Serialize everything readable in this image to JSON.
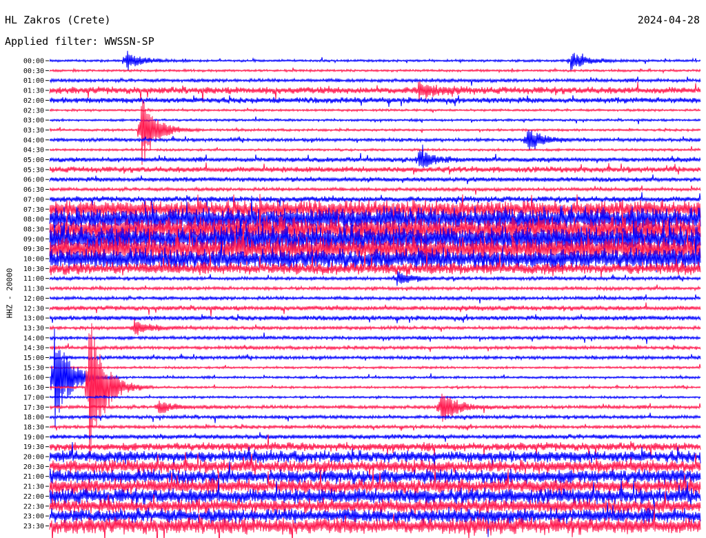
{
  "header": {
    "station": "HL Zakros (Crete)",
    "date": "2024-04-28",
    "filter": "Applied filter: WWSSN-SP"
  },
  "chart_data": {
    "type": "line",
    "ylabel": "HHZ - 20000",
    "yticks": [
      "00:00",
      "00:30",
      "01:00",
      "01:30",
      "02:00",
      "02:30",
      "03:00",
      "03:30",
      "04:00",
      "04:30",
      "05:00",
      "05:30",
      "06:00",
      "06:30",
      "07:00",
      "07:30",
      "08:00",
      "08:30",
      "09:00",
      "09:30",
      "10:00",
      "10:30",
      "11:00",
      "11:30",
      "12:00",
      "12:30",
      "13:00",
      "13:30",
      "14:00",
      "14:30",
      "15:00",
      "15:30",
      "16:00",
      "16:30",
      "17:00",
      "17:30",
      "18:00",
      "18:30",
      "19:00",
      "19:30",
      "20:00",
      "20:30",
      "21:00",
      "21:30",
      "22:00",
      "22:30",
      "23:00",
      "23:30"
    ],
    "colors": [
      "#0000ff",
      "#ff1a4f"
    ],
    "noise_level": [
      2,
      2,
      3,
      6,
      5,
      2,
      2,
      2,
      3,
      2,
      4,
      5,
      4,
      3,
      5,
      15,
      20,
      20,
      22,
      20,
      18,
      10,
      3,
      3,
      3,
      4,
      4,
      3,
      3,
      3,
      3,
      2,
      2,
      2,
      2,
      3,
      3,
      3,
      4,
      7,
      10,
      11,
      12,
      12,
      13,
      12,
      12,
      14
    ],
    "events": [
      {
        "time": "00:00",
        "minute": 3.5,
        "amp": 16
      },
      {
        "time": "00:00",
        "minute": 24,
        "amp": 14
      },
      {
        "time": "01:30",
        "minute": 17,
        "amp": 14
      },
      {
        "time": "03:30",
        "minute": 4.2,
        "amp": 60
      },
      {
        "time": "04:00",
        "minute": 22,
        "amp": 20
      },
      {
        "time": "05:00",
        "minute": 17,
        "amp": 14
      },
      {
        "time": "11:00",
        "minute": 16,
        "amp": 10
      },
      {
        "time": "13:30",
        "minute": 3.9,
        "amp": 12
      },
      {
        "time": "16:00",
        "minute": 0.2,
        "amp": 80
      },
      {
        "time": "16:30",
        "minute": 1.8,
        "amp": 120
      },
      {
        "time": "17:30",
        "minute": 18,
        "amp": 28
      },
      {
        "time": "17:30",
        "minute": 5,
        "amp": 10
      }
    ]
  }
}
